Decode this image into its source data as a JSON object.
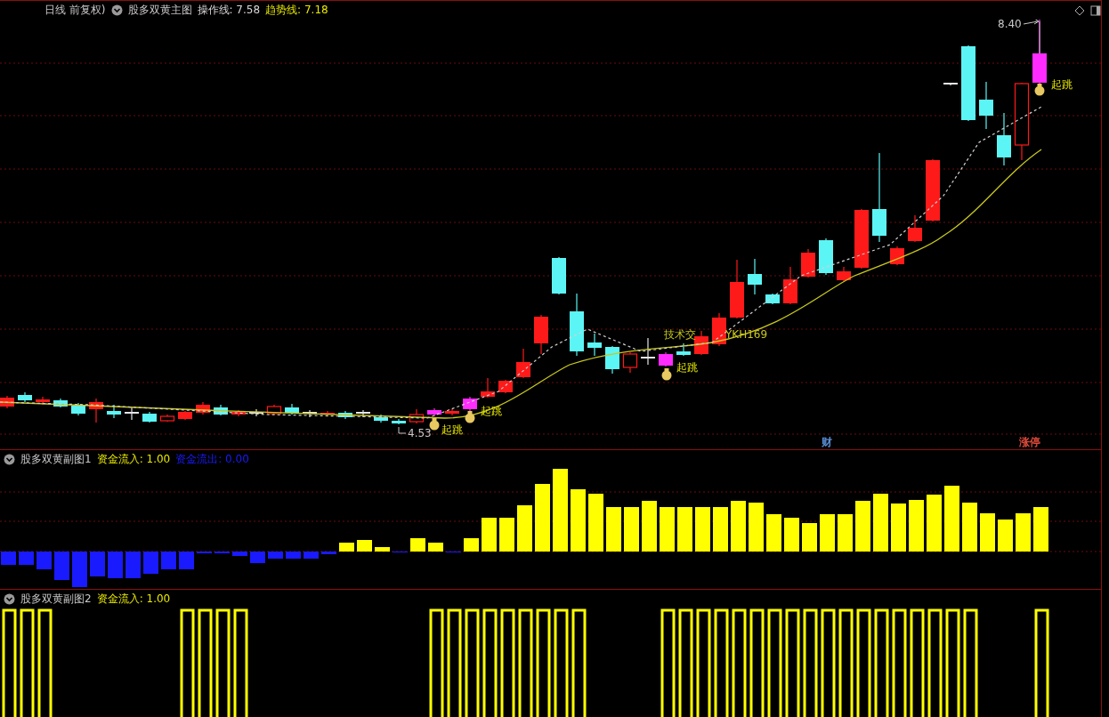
{
  "main_chart": {
    "period": "日线 前复权)",
    "title": "股多双黄主图",
    "legend": [
      {
        "label": "操作线: 7.58",
        "color": "#d8d8d8"
      },
      {
        "label": "趋势线: 7.18",
        "color": "#e8e800"
      }
    ],
    "high_label": "8.40",
    "low_label": "4.53",
    "signals": [
      {
        "label": "起跳"
      },
      {
        "label": "起跳"
      },
      {
        "label": "起跳"
      },
      {
        "label": "起跳"
      }
    ],
    "notes": [
      "技术交",
      "YKH169"
    ],
    "event_tags": [
      {
        "label": "财",
        "color": "#5b8fd6"
      },
      {
        "label": "涨停",
        "color": "#e04a3a"
      }
    ]
  },
  "sub_chart_1": {
    "title": "股多双黄副图1",
    "legend": [
      {
        "label": "资金流入: 1.00",
        "color": "#e8e800"
      },
      {
        "label": "资金流出: 0.00",
        "color": "#1a1aff"
      }
    ]
  },
  "sub_chart_2": {
    "title": "股多双黄副图2",
    "legend": [
      {
        "label": "资金流入: 1.00",
        "color": "#e8e800"
      }
    ]
  }
}
